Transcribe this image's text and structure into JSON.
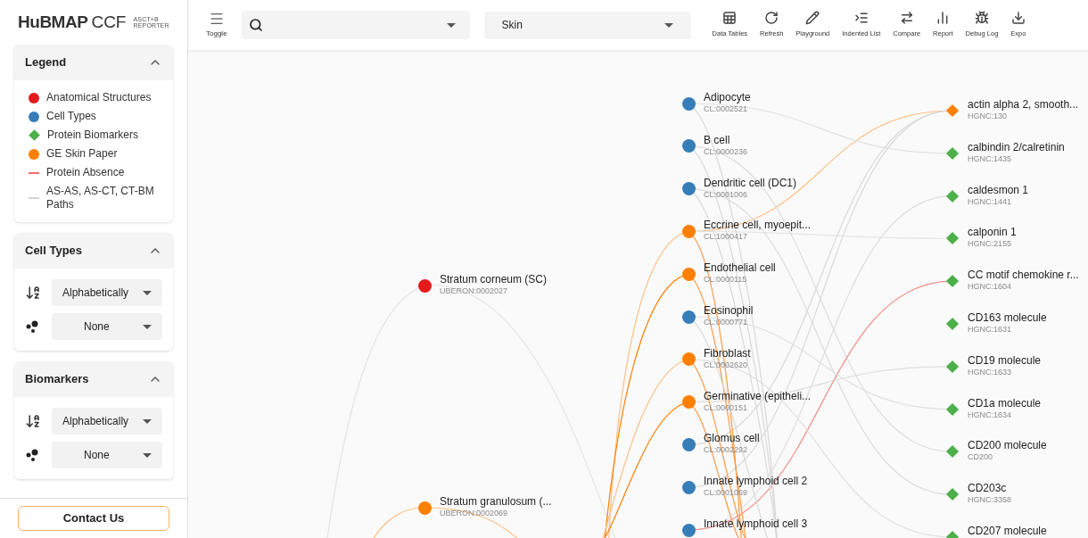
{
  "logo": {
    "brand": "HuBMAP",
    "product": "CCF",
    "subtitle_lines": [
      "ASCT+B",
      "REPORTER"
    ]
  },
  "sidebar": {
    "legend": {
      "title": "Legend",
      "expanded": true,
      "items": [
        {
          "label": "Anatomical Structures",
          "kind": "circle",
          "color": "#e41a1c"
        },
        {
          "label": "Cell Types",
          "kind": "circle",
          "color": "#377eb8"
        },
        {
          "label": "Protein Biomarkers",
          "kind": "diamond",
          "color": "#4daf4a"
        },
        {
          "label": "GE Skin Paper",
          "kind": "circle",
          "color": "#ff7f00"
        },
        {
          "label": "Protein Absence",
          "kind": "line",
          "color": "#ef6f6c"
        },
        {
          "label": "AS-AS, AS-CT, CT-BM Paths",
          "kind": "line",
          "color": "#d4d4d4"
        }
      ]
    },
    "panels": [
      {
        "title": "Cell Types",
        "expanded": true,
        "sort": "Alphabetically",
        "size": "None"
      },
      {
        "title": "Biomarkers",
        "expanded": true,
        "sort": "Alphabetically",
        "size": "None"
      }
    ],
    "contact_button": "Contact Us"
  },
  "toolbar": {
    "toggle": "Toggle",
    "organ": "Skin",
    "buttons": [
      {
        "label": "Data Tables",
        "kind": "tables"
      },
      {
        "label": "Refresh",
        "kind": "refresh"
      },
      {
        "label": "Playground",
        "kind": "pencil"
      },
      {
        "label": "Indented List",
        "kind": "indent"
      },
      {
        "label": "Compare",
        "kind": "compare"
      },
      {
        "label": "Report",
        "kind": "report"
      },
      {
        "label": "Debug Log",
        "kind": "bug"
      },
      {
        "label": "Expo",
        "kind": "download"
      }
    ]
  },
  "graph": {
    "columns": [
      {
        "kind": "as",
        "nodes": [
          {
            "name": "Stratum corneum (SC)",
            "id": "UBERON:0002027",
            "color": "#e41a1c"
          },
          {
            "name": "Stratum granulosum (...",
            "id": "UBERON:0002069",
            "color": "#ff7f00"
          }
        ]
      },
      {
        "kind": "ct",
        "nodes": [
          {
            "name": "Adipocyte",
            "id": "CL:0002521",
            "color": "#377eb8"
          },
          {
            "name": "B cell",
            "id": "CL:0000236",
            "color": "#377eb8"
          },
          {
            "name": "Dendritic cell (DC1)",
            "id": "CL:0001006",
            "color": "#377eb8"
          },
          {
            "name": "Eccrine cell, myoepit...",
            "id": "CL:1000417",
            "color": "#ff7f00"
          },
          {
            "name": "Endothelial cell",
            "id": "CL:0000115",
            "color": "#ff7f00"
          },
          {
            "name": "Eosinophil",
            "id": "CL:0000771",
            "color": "#377eb8"
          },
          {
            "name": "Fibroblast",
            "id": "CL:0002620",
            "color": "#ff7f00"
          },
          {
            "name": "Germinative (epitheli...",
            "id": "CL:0000151",
            "color": "#ff7f00"
          },
          {
            "name": "Glomus cell",
            "id": "CL:0002292",
            "color": "#377eb8"
          },
          {
            "name": "Innate lymphoid cell 2",
            "id": "CL:0001069",
            "color": "#377eb8"
          },
          {
            "name": "Innate lymphoid cell 3",
            "color": "#377eb8"
          }
        ]
      },
      {
        "kind": "bm",
        "nodes": [
          {
            "name": "actin alpha 2, smooth...",
            "id": "HGNC:130",
            "color": "#ff7f00"
          },
          {
            "name": "calbindin 2/calretinin",
            "id": "HGNC:1435",
            "color": "#4daf4a"
          },
          {
            "name": "caldesmon 1",
            "id": "HGNC:1441",
            "color": "#4daf4a"
          },
          {
            "name": "calponin 1",
            "id": "HGNC:2155",
            "color": "#4daf4a"
          },
          {
            "name": "CC motif chemokine r...",
            "id": "HGNC:1604",
            "color": "#4daf4a"
          },
          {
            "name": "CD163 molecule",
            "id": "HGNC:1631",
            "color": "#4daf4a"
          },
          {
            "name": "CD19 molecule",
            "id": "HGNC:1633",
            "color": "#4daf4a"
          },
          {
            "name": "CD1a molecule",
            "id": "HGNC:1634",
            "color": "#4daf4a"
          },
          {
            "name": "CD200 molecule",
            "id": "CD200",
            "color": "#4daf4a"
          },
          {
            "name": "CD203c",
            "id": "HGNC:3358",
            "color": "#4daf4a"
          },
          {
            "name": "CD207 molecule",
            "color": "#4daf4a"
          }
        ]
      }
    ]
  }
}
